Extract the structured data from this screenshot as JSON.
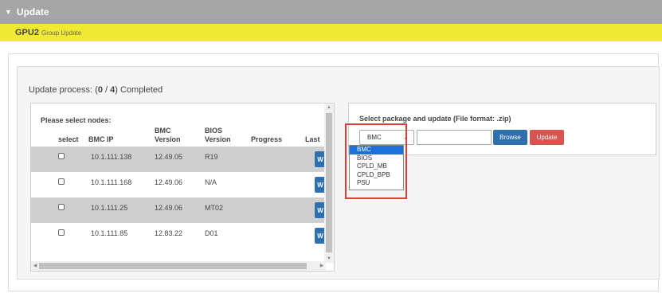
{
  "topbar": {
    "toggle_icon": "triangle-down-icon",
    "title": "Update"
  },
  "group": {
    "name": "GPU2",
    "subtitle": "Group Update"
  },
  "process": {
    "prefix": "Update process: (",
    "done": "0",
    "sep": " / ",
    "total": "4",
    "suffix": ") Completed"
  },
  "nodes": {
    "title": "Please select nodes:",
    "columns": {
      "select": "select",
      "bmc_ip": "BMC IP",
      "bmc_version_1": "BMC",
      "bmc_version_2": "Version",
      "bios_version_1": "BIOS",
      "bios_version_2": "Version",
      "progress": "Progress",
      "last": "Last"
    },
    "rows": [
      {
        "ip": "10.1.111.138",
        "bmc": "12.49.05",
        "bios": "R19",
        "progress": "",
        "action": "W"
      },
      {
        "ip": "10.1.111.168",
        "bmc": "12.49.06",
        "bios": "N/A",
        "progress": "",
        "action": "W"
      },
      {
        "ip": "10.1.111.25",
        "bmc": "12.49.06",
        "bios": "MT02",
        "progress": "",
        "action": "W"
      },
      {
        "ip": "10.1.111.85",
        "bmc": "12.83.22",
        "bios": "D01",
        "progress": "",
        "action": "W"
      }
    ]
  },
  "package": {
    "title": "Select package and update (File format: .zip)",
    "selected": "BMC",
    "options": [
      "BMC",
      "BIOS",
      "CPLD_MB",
      "CPLD_BPB",
      "PSU"
    ],
    "file_value": "",
    "browse_label": "Browse",
    "update_label": "Update"
  },
  "colors": {
    "topbar": "#a5a5a5",
    "group_bar": "#f0ea35",
    "primary_button": "#2f6fb0",
    "danger_button": "#d9534f",
    "highlight_frame": "#e03a3a",
    "selected_option": "#1e6fd9"
  }
}
